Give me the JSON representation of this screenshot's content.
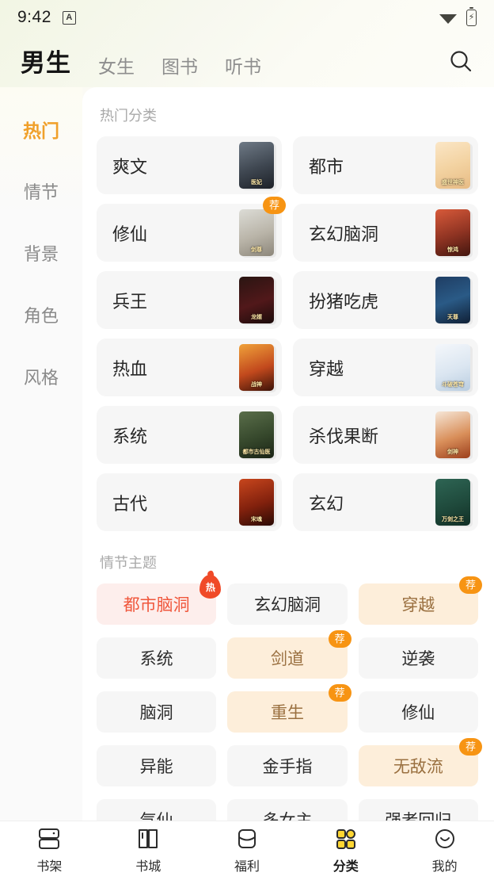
{
  "status_bar": {
    "time": "9:42",
    "app_glyph": "A",
    "wifi_icon": "wifi-icon",
    "battery_icon": "battery-charging-icon",
    "battery_bolt": "⚡"
  },
  "header": {
    "tabs": [
      {
        "label": "男生",
        "active": true
      },
      {
        "label": "女生",
        "active": false
      },
      {
        "label": "图书",
        "active": false
      },
      {
        "label": "听书",
        "active": false
      }
    ],
    "search_icon": "search-icon"
  },
  "sidebar": {
    "items": [
      {
        "label": "热门",
        "active": true
      },
      {
        "label": "情节",
        "active": false
      },
      {
        "label": "背景",
        "active": false
      },
      {
        "label": "角色",
        "active": false
      },
      {
        "label": "风格",
        "active": false
      }
    ]
  },
  "main": {
    "hot_section": {
      "title": "热门分类",
      "cards": [
        {
          "label": "爽文",
          "badge": "",
          "cover_text": "医妃",
          "cover_bg": "linear-gradient(160deg,#6f7a86 0%,#3e4650 55%,#1d2128 100%)"
        },
        {
          "label": "都市",
          "badge": "",
          "cover_text": "盛世神医",
          "cover_bg": "linear-gradient(160deg,#fbe6c6 0%,#f3d3a2 50%,#e7bb84 100%)"
        },
        {
          "label": "修仙",
          "badge": "荐",
          "cover_text": "剑尊",
          "cover_bg": "linear-gradient(160deg,#dcdcd6 0%,#b9b4a8 55%,#8c867a 100%)"
        },
        {
          "label": "玄幻脑洞",
          "badge": "",
          "cover_text": "惊鸿",
          "cover_bg": "linear-gradient(160deg,#d85a3a 0%,#8e3322 55%,#43160f 100%)"
        },
        {
          "label": "兵王",
          "badge": "",
          "cover_text": "龙婿",
          "cover_bg": "linear-gradient(160deg,#2a1512 0%,#51181a 55%,#1b0c0b 100%)"
        },
        {
          "label": "扮猪吃虎",
          "badge": "",
          "cover_text": "天尊",
          "cover_bg": "linear-gradient(160deg,#1f3d63 0%,#2a5a86 50%,#102036 100%)"
        },
        {
          "label": "热血",
          "badge": "",
          "cover_text": "战神",
          "cover_bg": "linear-gradient(160deg,#f0a23a 0%,#c2491d 55%,#3b1208 100%)"
        },
        {
          "label": "穿越",
          "badge": "",
          "cover_text": "斗破苍穹",
          "cover_bg": "linear-gradient(160deg,#f4f7fb 0%,#dbe6f1 55%,#b9cde0 100%)"
        },
        {
          "label": "系统",
          "badge": "",
          "cover_text": "都市古仙医",
          "cover_bg": "linear-gradient(160deg,#5a6e4a 0%,#36482c 55%,#1b2415 100%)"
        },
        {
          "label": "杀伐果断",
          "badge": "",
          "cover_text": "剑神",
          "cover_bg": "linear-gradient(160deg,#f6e7d8 0%,#d98f5a 55%,#9c3f1c 100%)"
        },
        {
          "label": "古代",
          "badge": "",
          "cover_text": "宋魂",
          "cover_bg": "linear-gradient(160deg,#c8461d 0%,#82210d 55%,#2a0a04 100%)"
        },
        {
          "label": "玄幻",
          "badge": "",
          "cover_text": "万剑之王",
          "cover_bg": "linear-gradient(160deg,#2e6554 0%,#1f4a3c 55%,#123026 100%)"
        }
      ]
    },
    "theme_section": {
      "title": "情节主题",
      "tags": [
        {
          "label": "都市脑洞",
          "badge": "热",
          "style": "hot"
        },
        {
          "label": "玄幻脑洞",
          "badge": "",
          "style": "plain"
        },
        {
          "label": "穿越",
          "badge": "荐",
          "style": "rec"
        },
        {
          "label": "系统",
          "badge": "",
          "style": "plain"
        },
        {
          "label": "剑道",
          "badge": "荐",
          "style": "rec"
        },
        {
          "label": "逆袭",
          "badge": "",
          "style": "plain"
        },
        {
          "label": "脑洞",
          "badge": "",
          "style": "plain"
        },
        {
          "label": "重生",
          "badge": "荐",
          "style": "rec"
        },
        {
          "label": "修仙",
          "badge": "",
          "style": "plain"
        },
        {
          "label": "异能",
          "badge": "",
          "style": "plain"
        },
        {
          "label": "金手指",
          "badge": "",
          "style": "plain"
        },
        {
          "label": "无敌流",
          "badge": "荐",
          "style": "rec"
        },
        {
          "label": "气仙",
          "badge": "",
          "style": "plain"
        },
        {
          "label": "多女主",
          "badge": "",
          "style": "plain"
        },
        {
          "label": "强者回归",
          "badge": "",
          "style": "plain"
        }
      ]
    }
  },
  "bottom_nav": {
    "items": [
      {
        "label": "书架",
        "icon": "bookshelf-icon",
        "active": false
      },
      {
        "label": "书城",
        "icon": "open-book-icon",
        "active": false
      },
      {
        "label": "福利",
        "icon": "gift-box-icon",
        "active": false
      },
      {
        "label": "分类",
        "icon": "grid-category-icon",
        "active": true
      },
      {
        "label": "我的",
        "icon": "profile-smiley-icon",
        "active": false
      }
    ]
  },
  "colors": {
    "accent_orange": "#f0a02a",
    "badge_orange": "#f79413",
    "badge_hot_red": "#f04a28",
    "tab_highlight_yellow": "#ffe94a",
    "nav_active_yellow": "#ffd633",
    "card_bg": "#f6f6f6",
    "tag_hot_bg": "#fdeeec",
    "tag_rec_bg": "#fdeeda"
  }
}
